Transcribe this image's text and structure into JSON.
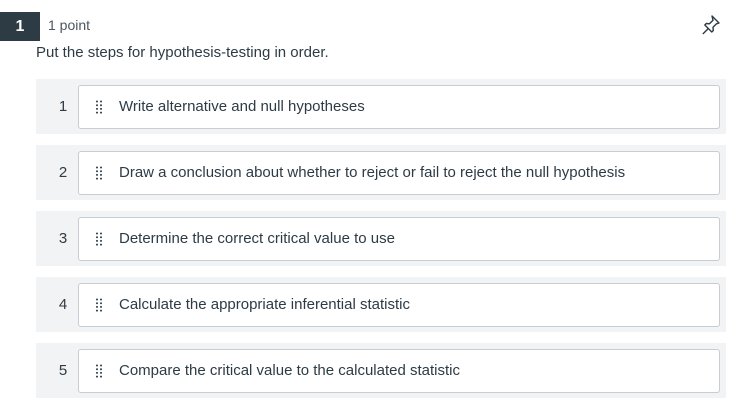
{
  "question": {
    "number": "1",
    "points": "1 point",
    "prompt": "Put the steps for hypothesis-testing in order."
  },
  "items": [
    {
      "position": "1",
      "text": "Write alternative and null hypotheses"
    },
    {
      "position": "2",
      "text": "Draw a conclusion about whether to reject or fail to reject the null hypothesis"
    },
    {
      "position": "3",
      "text": "Determine the correct critical value to use"
    },
    {
      "position": "4",
      "text": "Calculate the appropriate inferential statistic"
    },
    {
      "position": "5",
      "text": "Compare the critical value to the calculated statistic"
    }
  ],
  "icons": {
    "pin": "pin-icon",
    "handle": "drag-handle-icon"
  },
  "colors": {
    "question_badge": "#2d3b45",
    "row_background": "#f2f3f4",
    "card_border": "#c7cdd1"
  }
}
